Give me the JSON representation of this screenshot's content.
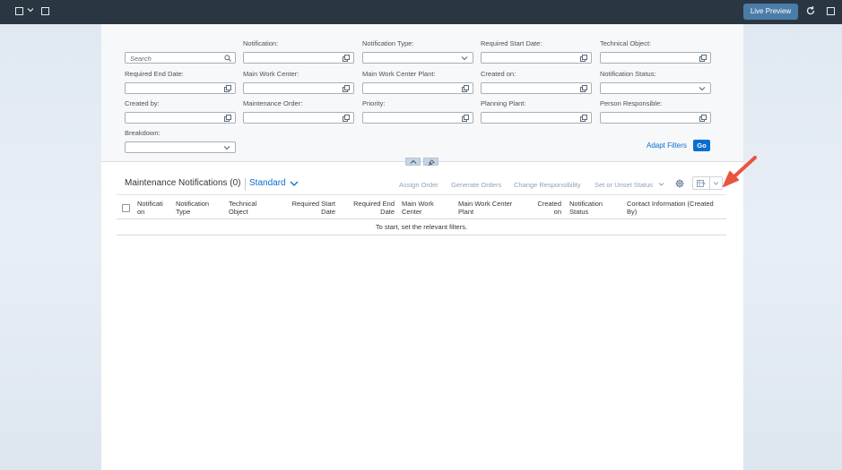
{
  "topbar": {
    "live_preview_label": "Live Preview"
  },
  "filters": [
    {
      "label": "",
      "placeholder": "Search",
      "icon": "search-icon"
    },
    {
      "label": "Notification:",
      "placeholder": "",
      "icon": "value-help-icon"
    },
    {
      "label": "Notification Type:",
      "placeholder": "",
      "icon": "dropdown-icon"
    },
    {
      "label": "Required Start Date:",
      "placeholder": "",
      "icon": "value-help-icon"
    },
    {
      "label": "Technical Object:",
      "placeholder": "",
      "icon": "value-help-icon"
    },
    {
      "label": "Required End Date:",
      "placeholder": "",
      "icon": "value-help-icon"
    },
    {
      "label": "Main Work Center:",
      "placeholder": "",
      "icon": "value-help-icon"
    },
    {
      "label": "Main Work Center Plant:",
      "placeholder": "",
      "icon": "value-help-icon"
    },
    {
      "label": "Created on:",
      "placeholder": "",
      "icon": "value-help-icon"
    },
    {
      "label": "Notification Status:",
      "placeholder": "",
      "icon": "dropdown-icon"
    },
    {
      "label": "Created by:",
      "placeholder": "",
      "icon": "value-help-icon"
    },
    {
      "label": "Maintenance Order:",
      "placeholder": "",
      "icon": "value-help-icon"
    },
    {
      "label": "Priority:",
      "placeholder": "",
      "icon": "value-help-icon"
    },
    {
      "label": "Planning Plant:",
      "placeholder": "",
      "icon": "value-help-icon"
    },
    {
      "label": "Person Responsible:",
      "placeholder": "",
      "icon": "value-help-icon"
    },
    {
      "label": "Breakdown:",
      "placeholder": "",
      "icon": "dropdown-icon"
    }
  ],
  "filterbar": {
    "adapt_filters_label": "Adapt Filters",
    "go_label": "Go"
  },
  "table": {
    "title": "Maintenance Notifications (0)",
    "variant": "Standard",
    "toolbar": {
      "assign_order": "Assign Order",
      "generate_orders": "Generate Orders",
      "change_responsibility": "Change Responsibility",
      "set_unset_status": "Set or Unset Status"
    },
    "columns": [
      {
        "line1": "Notificati",
        "line2": "on"
      },
      {
        "line1": "Notification",
        "line2": "Type"
      },
      {
        "line1": "Technical",
        "line2": "Object"
      },
      {
        "line1": "Required Start",
        "line2": "Date"
      },
      {
        "line1": "Required End",
        "line2": "Date"
      },
      {
        "line1": "Main Work",
        "line2": "Center"
      },
      {
        "line1": "Main Work Center",
        "line2": "Plant"
      },
      {
        "line1": "Created",
        "line2": "on"
      },
      {
        "line1": "Notification",
        "line2": "Status"
      },
      {
        "line1": "Contact Information (Created",
        "line2": "By)"
      }
    ],
    "empty_message": "To start, set the relevant filters."
  },
  "colors": {
    "shell_bar": "#2b3643",
    "accent": "#0a6ed1",
    "annotation_arrow": "#e8553e"
  }
}
